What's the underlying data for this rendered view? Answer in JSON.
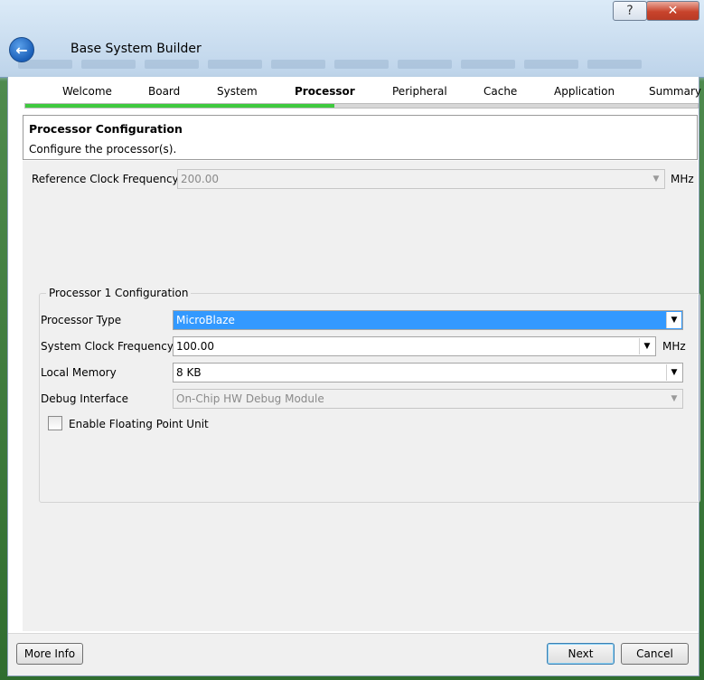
{
  "window": {
    "title": "Base System Builder",
    "help_symbol": "?",
    "close_symbol": "✕"
  },
  "wizard": {
    "steps": [
      {
        "label": "Welcome",
        "active": false
      },
      {
        "label": "Board",
        "active": false
      },
      {
        "label": "System",
        "active": false
      },
      {
        "label": "Processor",
        "active": true
      },
      {
        "label": "Peripheral",
        "active": false
      },
      {
        "label": "Cache",
        "active": false
      },
      {
        "label": "Application",
        "active": false
      },
      {
        "label": "Summary",
        "active": false
      }
    ],
    "progress_fraction": 0.46
  },
  "header": {
    "title": "Processor Configuration",
    "subtitle": "Configure the processor(s)."
  },
  "form": {
    "ref_clock_label": "Reference Clock Frequency",
    "ref_clock_value": "200.00",
    "ref_clock_unit": "MHz",
    "group_label": "Processor 1 Configuration",
    "processor_type_label": "Processor Type",
    "processor_type_value": "MicroBlaze",
    "sys_clock_label": "System Clock Frequency",
    "sys_clock_value": "100.00",
    "sys_clock_unit": "MHz",
    "local_memory_label": "Local Memory",
    "local_memory_value": "8 KB",
    "debug_label": "Debug Interface",
    "debug_value": "On-Chip HW Debug Module",
    "fpu_label": "Enable Floating Point Unit",
    "fpu_checked": false
  },
  "footer": {
    "more_info": "More Info",
    "next": "Next",
    "cancel": "Cancel"
  },
  "icons": {
    "back": "back-arrow-icon",
    "dropdown": "chevron-down-icon"
  }
}
